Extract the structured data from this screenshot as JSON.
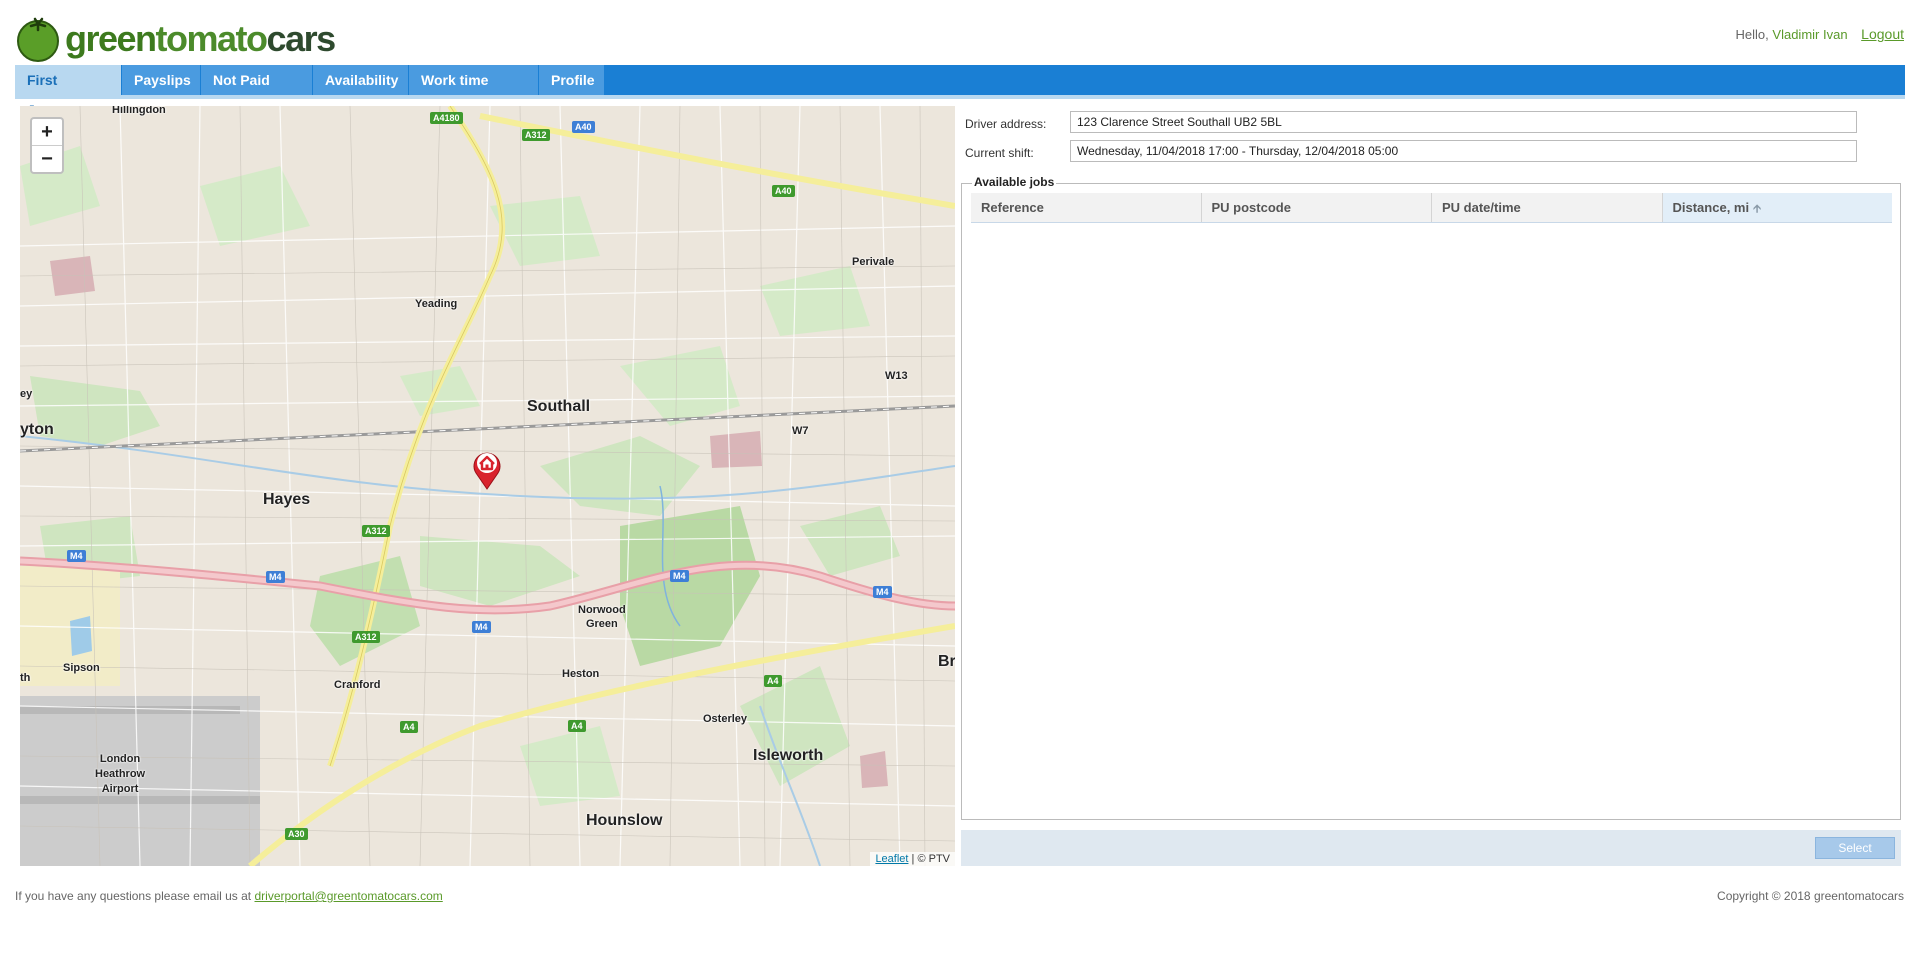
{
  "brand": {
    "logo_text_1": "green",
    "logo_text_2": "tomato",
    "logo_text_3": "cars"
  },
  "user": {
    "greeting": "Hello,",
    "name": "Vladimir Ivan",
    "logout": "Logout"
  },
  "tabs": [
    {
      "label": "First Journey",
      "active": true
    },
    {
      "label": "Payslips"
    },
    {
      "label": "Not Paid Jobs"
    },
    {
      "label": "Availability"
    },
    {
      "label": "Work time report"
    },
    {
      "label": "Profile"
    }
  ],
  "map": {
    "zoom_in": "+",
    "zoom_out": "−",
    "attribution_link": "Leaflet",
    "attribution_rest": "| © PTV",
    "places": {
      "hillingdon": "Hillingdon",
      "yeading": "Yeading",
      "perivale": "Perivale",
      "w13": "W13",
      "southall": "Southall",
      "w7": "W7",
      "yton": "yton",
      "ey": "ey",
      "hayes": "Hayes",
      "norwood_green": "Norwood\nGreen",
      "heston": "Heston",
      "sipson": "Sipson",
      "th": "th",
      "cranford": "Cranford",
      "osterley": "Osterley",
      "isleworth": "Isleworth",
      "heathrow": "London\nHeathrow\nAirport",
      "hounslow": "Hounslow",
      "br": "Br"
    },
    "shields": {
      "a4180": "A4180",
      "a40a": "A40",
      "a312a": "A312",
      "a40b": "A40",
      "m4a": "M4",
      "m4b": "M4",
      "a312b": "A312",
      "m4c": "M4",
      "m4d": "M4",
      "m4e": "M4",
      "a312c": "A312",
      "a4a": "A4",
      "a4b": "A4",
      "a4c": "A4",
      "a30": "A30"
    }
  },
  "form": {
    "driver_address_label": "Driver address:",
    "driver_address_value": "123 Clarence Street Southall UB2 5BL",
    "current_shift_label": "Current shift:",
    "current_shift_value": "Wednesday, 11/04/2018 17:00 - Thursday, 12/04/2018 05:00"
  },
  "jobs": {
    "legend": "Available jobs",
    "columns": [
      "Reference",
      "PU postcode",
      "PU date/time",
      "Distance, mi"
    ],
    "rows": [],
    "select_label": "Select"
  },
  "footer": {
    "question_text": "If you have any questions please email us at",
    "email": "driverportal@greentomatocars.com",
    "copyright": "Copyright © 2018 greentomatocars"
  }
}
